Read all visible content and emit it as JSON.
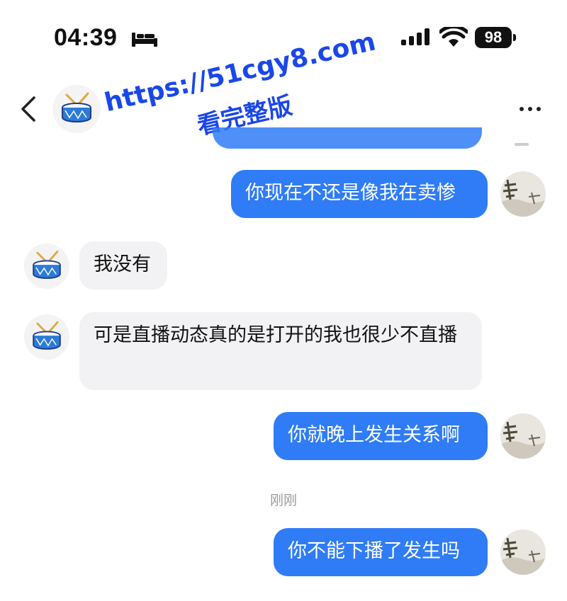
{
  "status_bar": {
    "time": "04:39",
    "battery": "98",
    "icons": [
      "bed-icon",
      "signal-icon",
      "wifi-icon",
      "battery-icon"
    ]
  },
  "header": {
    "icons": [
      "back-chevron-icon",
      "drum-avatar-icon",
      "more-dots-icon"
    ]
  },
  "watermark": {
    "url": "https://51cgy8.com",
    "subtitle": "看完整版"
  },
  "messages": [
    {
      "side": "sent",
      "text": "你现在不还是像我在卖惨"
    },
    {
      "side": "received",
      "text": "我没有"
    },
    {
      "side": "received",
      "text": "可是直播动态真的是打开的我也很少不直播"
    },
    {
      "side": "sent",
      "text": "你就晚上发生关系啊"
    },
    {
      "side": "sent",
      "text": "你不能下播了发生吗"
    }
  ],
  "timestamp": "刚刚",
  "colors": {
    "sent_bubble": "#2f7cf6",
    "received_bubble": "#f2f2f4",
    "watermark": "#1a47e8"
  }
}
